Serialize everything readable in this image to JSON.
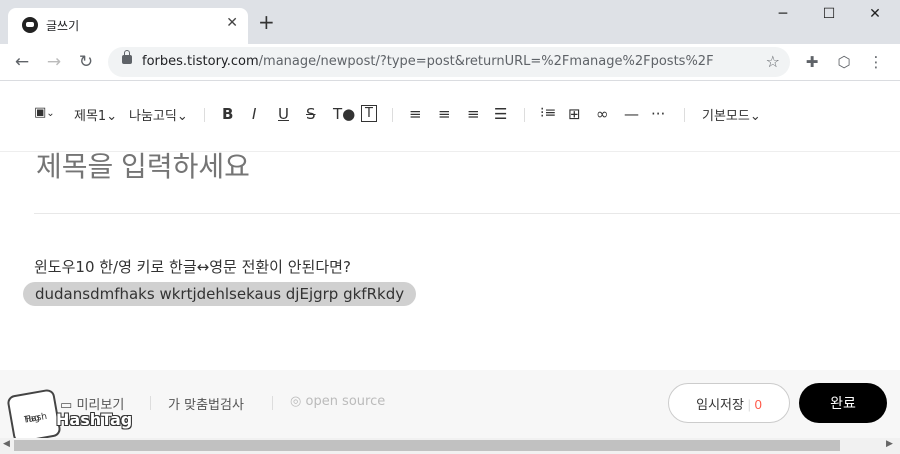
{
  "browser": {
    "tab_title": "글쓰기",
    "close_glyph": "✕",
    "newtab_glyph": "+",
    "window_buttons": [
      "─",
      "☐",
      "✕"
    ],
    "url_host": "forbes.tistory.com",
    "url_path": "/manage/newpost/?type=post&returnURL=%2Fmanage%2Fposts%2F"
  },
  "editor_toolbar": {
    "heading": "제목1",
    "font": "나눔고딕",
    "mode": "기본모드",
    "chevron": "⌄"
  },
  "post": {
    "title_placeholder": "제목을 입력하세요",
    "line1": "윈도우10 한/영 키로 한글↔영문 전환이 안된다면?",
    "line2": "dudansdmfhaks wkrtjdehlsekaus djEjgrp gkfRkdy"
  },
  "bottom": {
    "preview": "미리보기",
    "spellcheck": "맞춤법검사",
    "open_source": "open source",
    "temp_save": "임시저장",
    "temp_count": "0",
    "done": "완료"
  },
  "watermark": {
    "text": "HashTag",
    "badge_line1": "Hash",
    "badge_line2": "Tag"
  },
  "colors": {
    "accent": "#ff5544",
    "done_bg": "#000000",
    "tabbar_bg": "#dee1e6"
  }
}
